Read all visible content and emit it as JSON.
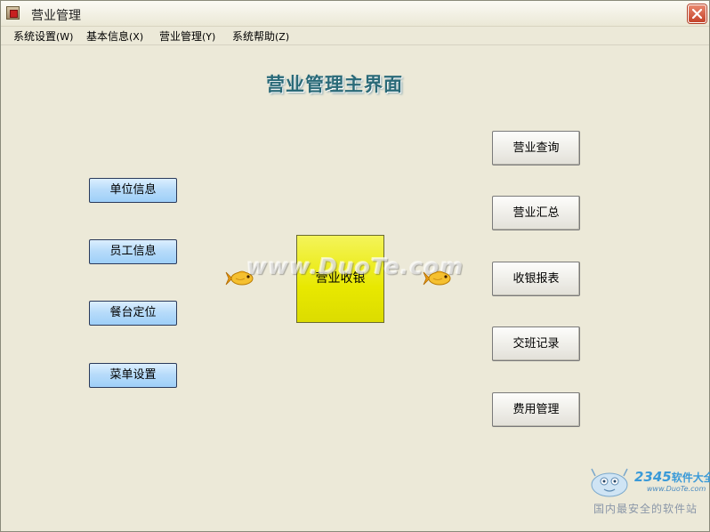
{
  "window": {
    "title": "营业管理"
  },
  "menu": [
    {
      "label": "系统设置",
      "hotkey": "(W)"
    },
    {
      "label": "基本信息",
      "hotkey": "(X)"
    },
    {
      "label": "营业管理",
      "hotkey": "(Y)"
    },
    {
      "label": "系统帮助",
      "hotkey": "(Z)"
    }
  ],
  "page_title": "营业管理主界面",
  "left_buttons": [
    {
      "label": "单位信息"
    },
    {
      "label": "员工信息"
    },
    {
      "label": "餐台定位"
    },
    {
      "label": "菜单设置"
    }
  ],
  "center_button": {
    "label": "营业收银"
  },
  "right_buttons": [
    {
      "label": "营业查询"
    },
    {
      "label": "营业汇总"
    },
    {
      "label": "收银报表"
    },
    {
      "label": "交班记录"
    },
    {
      "label": "费用管理"
    }
  ],
  "watermark": {
    "text": "www.DuoTe.com"
  },
  "logo": {
    "brand_num": "2345",
    "brand_cn": "软件大全",
    "url": "www.DuoTe.com",
    "slogan": "国内最安全的软件站"
  },
  "icons": {
    "app": "app-icon",
    "close": "close-icon",
    "arrow": "goldfish-arrow-icon"
  },
  "colors": {
    "window_bg": "#ece9d8",
    "title_text": "#2a6a78",
    "blue_button": "#b8dcfa",
    "center_button": "#e8e800",
    "fish": "#f0b020"
  }
}
